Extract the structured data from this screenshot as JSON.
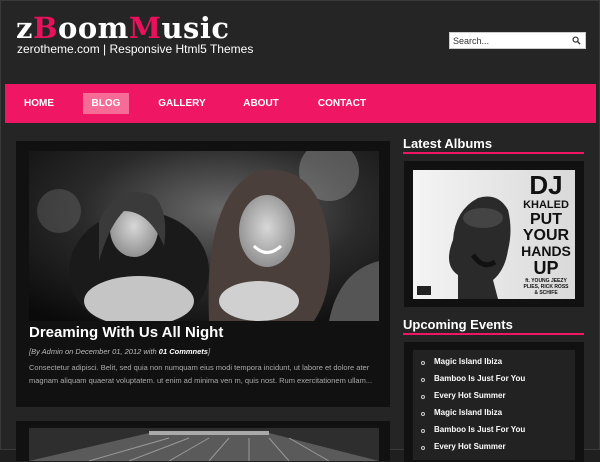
{
  "header": {
    "logo_part1": "z",
    "logo_part2": "B",
    "logo_part3": "oom",
    "logo_part4": "M",
    "logo_part5": "usic",
    "tagline": "zerotheme.com | Responsive Html5 Themes"
  },
  "search": {
    "placeholder": "Search..."
  },
  "nav": {
    "items": [
      {
        "label": "HOME"
      },
      {
        "label": "BLOG"
      },
      {
        "label": "GALLERY"
      },
      {
        "label": "ABOUT"
      },
      {
        "label": "CONTACT"
      }
    ],
    "active": "BLOG"
  },
  "post": {
    "title": "Dreaming With Us All Night",
    "meta_prefix": "[By Admin on December 01, 2012 with ",
    "meta_comments": "01 Commnets",
    "meta_suffix": "]",
    "excerpt": "Consectetur adipisci. Belit, sed quia non numquam eius modi tempora incidunt, ut labore et dolore ater magnam aliquam quaerat voluptatem. ut enim ad minima ven m, quis nost. Rum exercitationem ullam..."
  },
  "sidebar": {
    "albums_title": "Latest Albums",
    "album_art": {
      "line1": "DJ",
      "line2": "KHALED",
      "line3": "PUT",
      "line4": "YOUR",
      "line5": "HANDS",
      "line6": "UP",
      "line7": "ft. YOUNG JEEZY",
      "line8": "PLIES, RICK ROSS",
      "line9": "& SCHIFE"
    },
    "events_title": "Upcoming Events",
    "events": [
      {
        "label": "Magic Island Ibiza"
      },
      {
        "label": "Bamboo Is Just For You"
      },
      {
        "label": "Every Hot Summer"
      },
      {
        "label": "Magic Island Ibiza"
      },
      {
        "label": "Bamboo Is Just For You"
      },
      {
        "label": "Every Hot Summer"
      }
    ]
  },
  "colors": {
    "accent": "#ef1663",
    "nav_active": "#f66c97",
    "background": "#252525",
    "panel": "#111111"
  }
}
